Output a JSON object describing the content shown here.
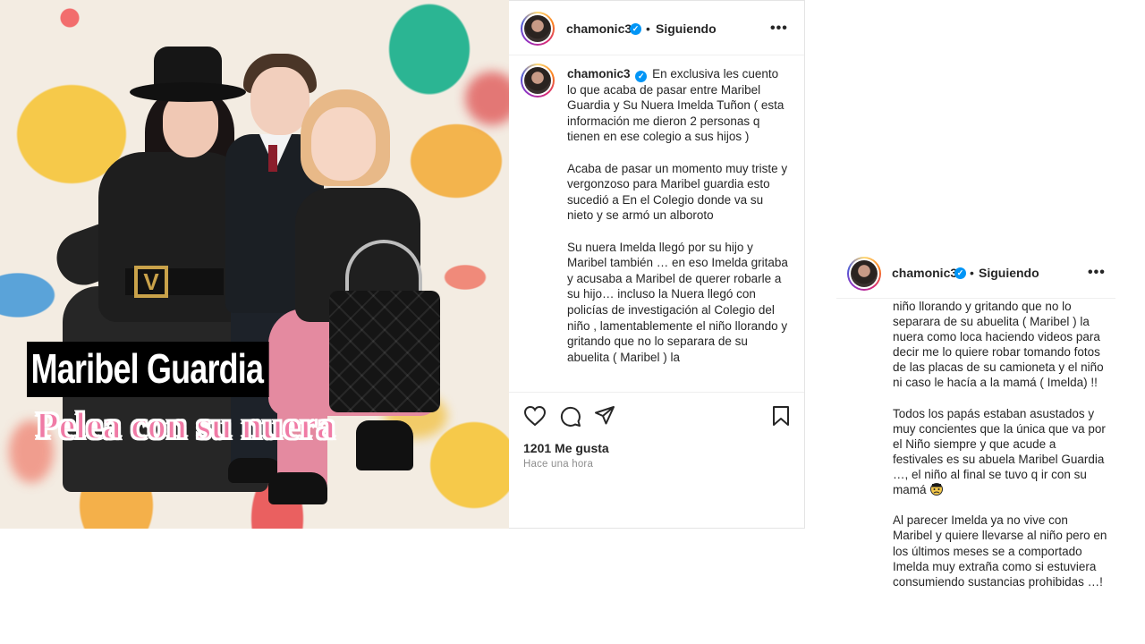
{
  "post": {
    "image": {
      "headline": "Maribel Guardia",
      "subheadline": "Pelea con su nuera",
      "buckle_logo": "V"
    },
    "header": {
      "username": "chamonic3",
      "verified_icon": "verified-badge-icon",
      "separator": "•",
      "follow_status": "Siguiendo",
      "more_icon": "•••"
    },
    "caption": {
      "username": "chamonic3",
      "paragraphs": [
        "En exclusiva les cuento lo que acaba de pasar entre Maribel Guardia y Su Nuera Imelda Tuñon ( esta información me dieron 2 personas q tienen en ese colegio a sus hijos )",
        "Acaba de pasar un momento muy triste y vergonzoso para Maribel guardia esto sucedió a En el Colegio donde va su nieto y se armó un alboroto",
        "Su nuera Imelda llegó por su hijo y Maribel también … en eso Imelda gritaba y acusaba a Maribel de querer robarle a su hijo… incluso la Nuera llegó con policías de investigación al Colegio del niño , lamentablemente el niño llorando y gritando que no lo separara de su abuelita ( Maribel ) la"
      ]
    },
    "actions": {
      "like_icon": "heart-icon",
      "comment_icon": "comment-icon",
      "share_icon": "share-icon",
      "save_icon": "bookmark-icon"
    },
    "likes": "1201 Me gusta",
    "time": "Hace una hora"
  },
  "crop2": {
    "header": {
      "username": "chamonic3",
      "separator": "•",
      "follow_status": "Siguiendo",
      "more_icon": "•••"
    },
    "paragraphs": [
      "niño llorando y gritando que no lo separara de su abuelita ( Maribel ) la nuera como loca haciendo videos para decir me lo quiere robar tomando fotos de las placas de su camioneta y el niño ni caso le hacía a la mamá ( Imelda) !!",
      "Todos los papás estaban asustados y muy concientes que la única que va por el Niño siempre y que acude a festivales es su abuela Maribel Guardia …, el niño al final se tuvo q ir con su mamá",
      "Al parecer Imelda ya no vive con Maribel y quiere llevarse al niño pero en los últimos meses se a comportado Imelda muy extraña como si estuviera consumiendo sustancias prohibidas …!"
    ],
    "emoji": "sad-face-emoji"
  },
  "colors": {
    "verified_blue": "#0095f6",
    "text": "#262626",
    "muted": "#8e8e8e",
    "headline_pink": "#f07ba6"
  }
}
